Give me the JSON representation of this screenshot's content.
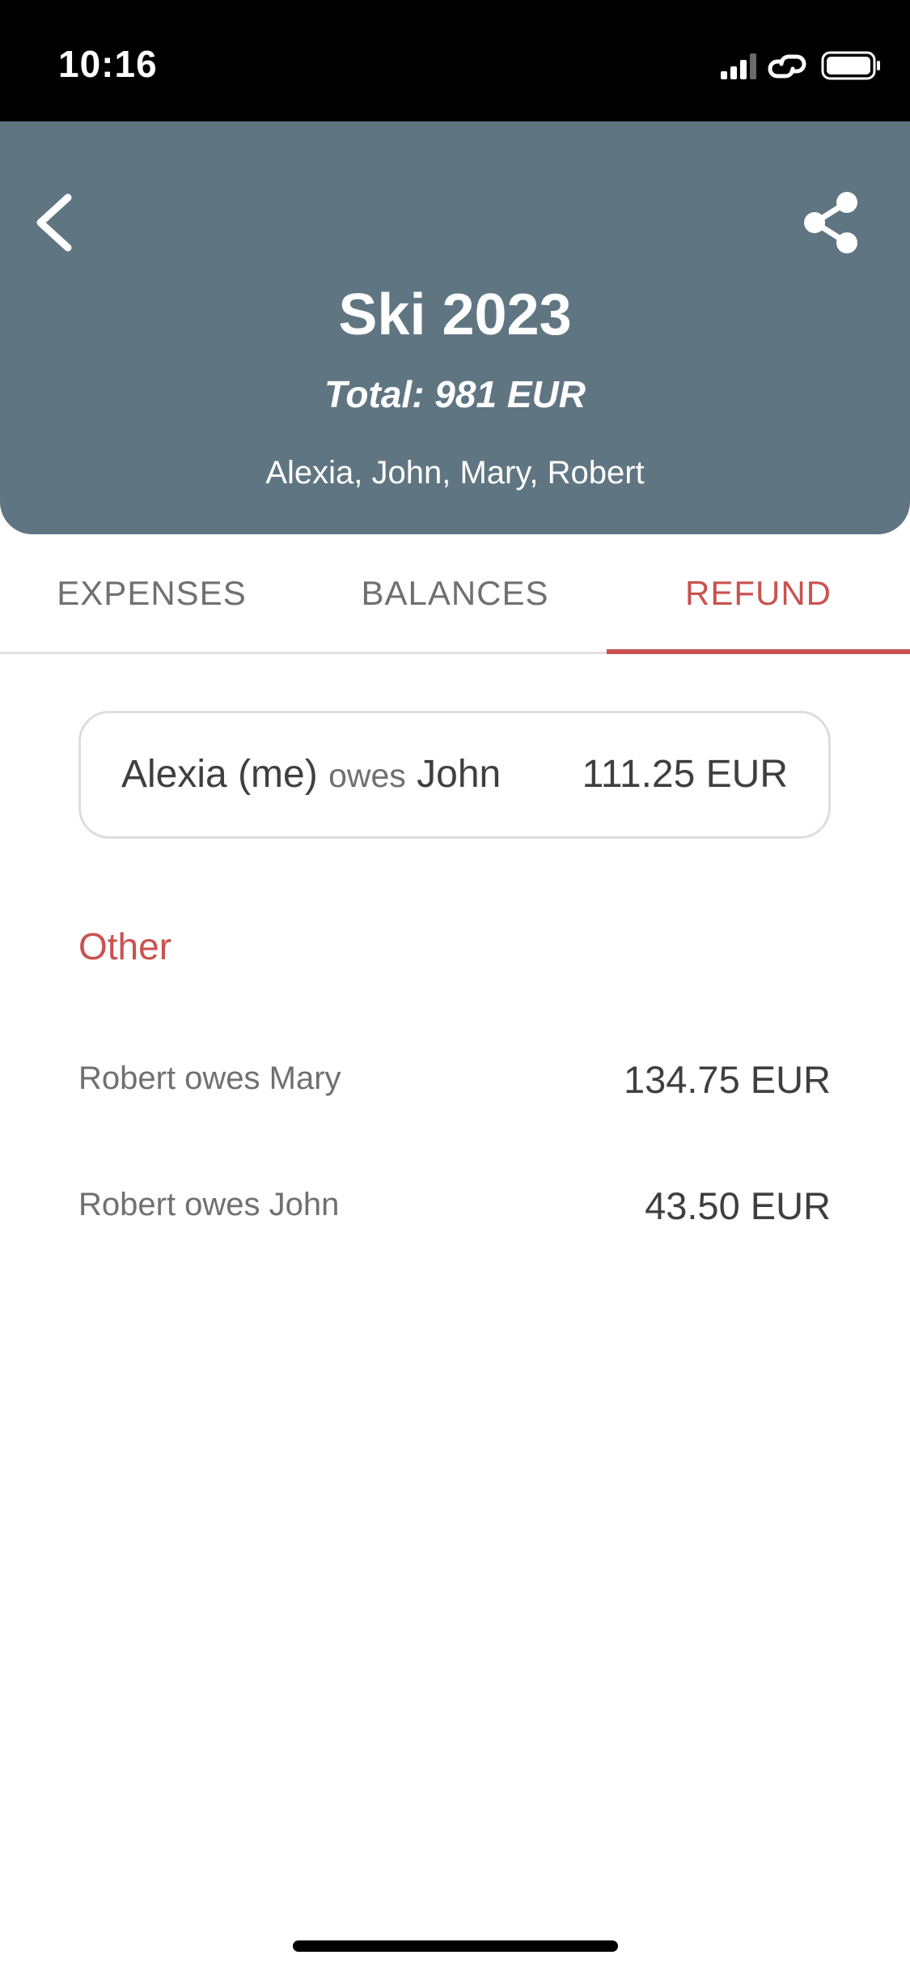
{
  "status_bar": {
    "time": "10:16"
  },
  "header": {
    "title": "Ski 2023",
    "total": "Total: 981 EUR",
    "members": "Alexia, John, Mary, Robert",
    "background": "#607582"
  },
  "tabs": [
    {
      "label": "EXPENSES",
      "active": false
    },
    {
      "label": "BALANCES",
      "active": false
    },
    {
      "label": "REFUND",
      "active": true
    }
  ],
  "my_refund": {
    "debtor": "Alexia (me)",
    "verb": "owes",
    "creditor": "John",
    "amount": "111.25 EUR"
  },
  "other": {
    "title": "Other",
    "items": [
      {
        "description": "Robert owes Mary",
        "amount": "134.75 EUR"
      },
      {
        "description": "Robert owes John",
        "amount": "43.50 EUR"
      }
    ]
  },
  "colors": {
    "accent": "#c9524f",
    "header": "#607582",
    "text": "#3f3f3f",
    "muted": "#707070"
  }
}
